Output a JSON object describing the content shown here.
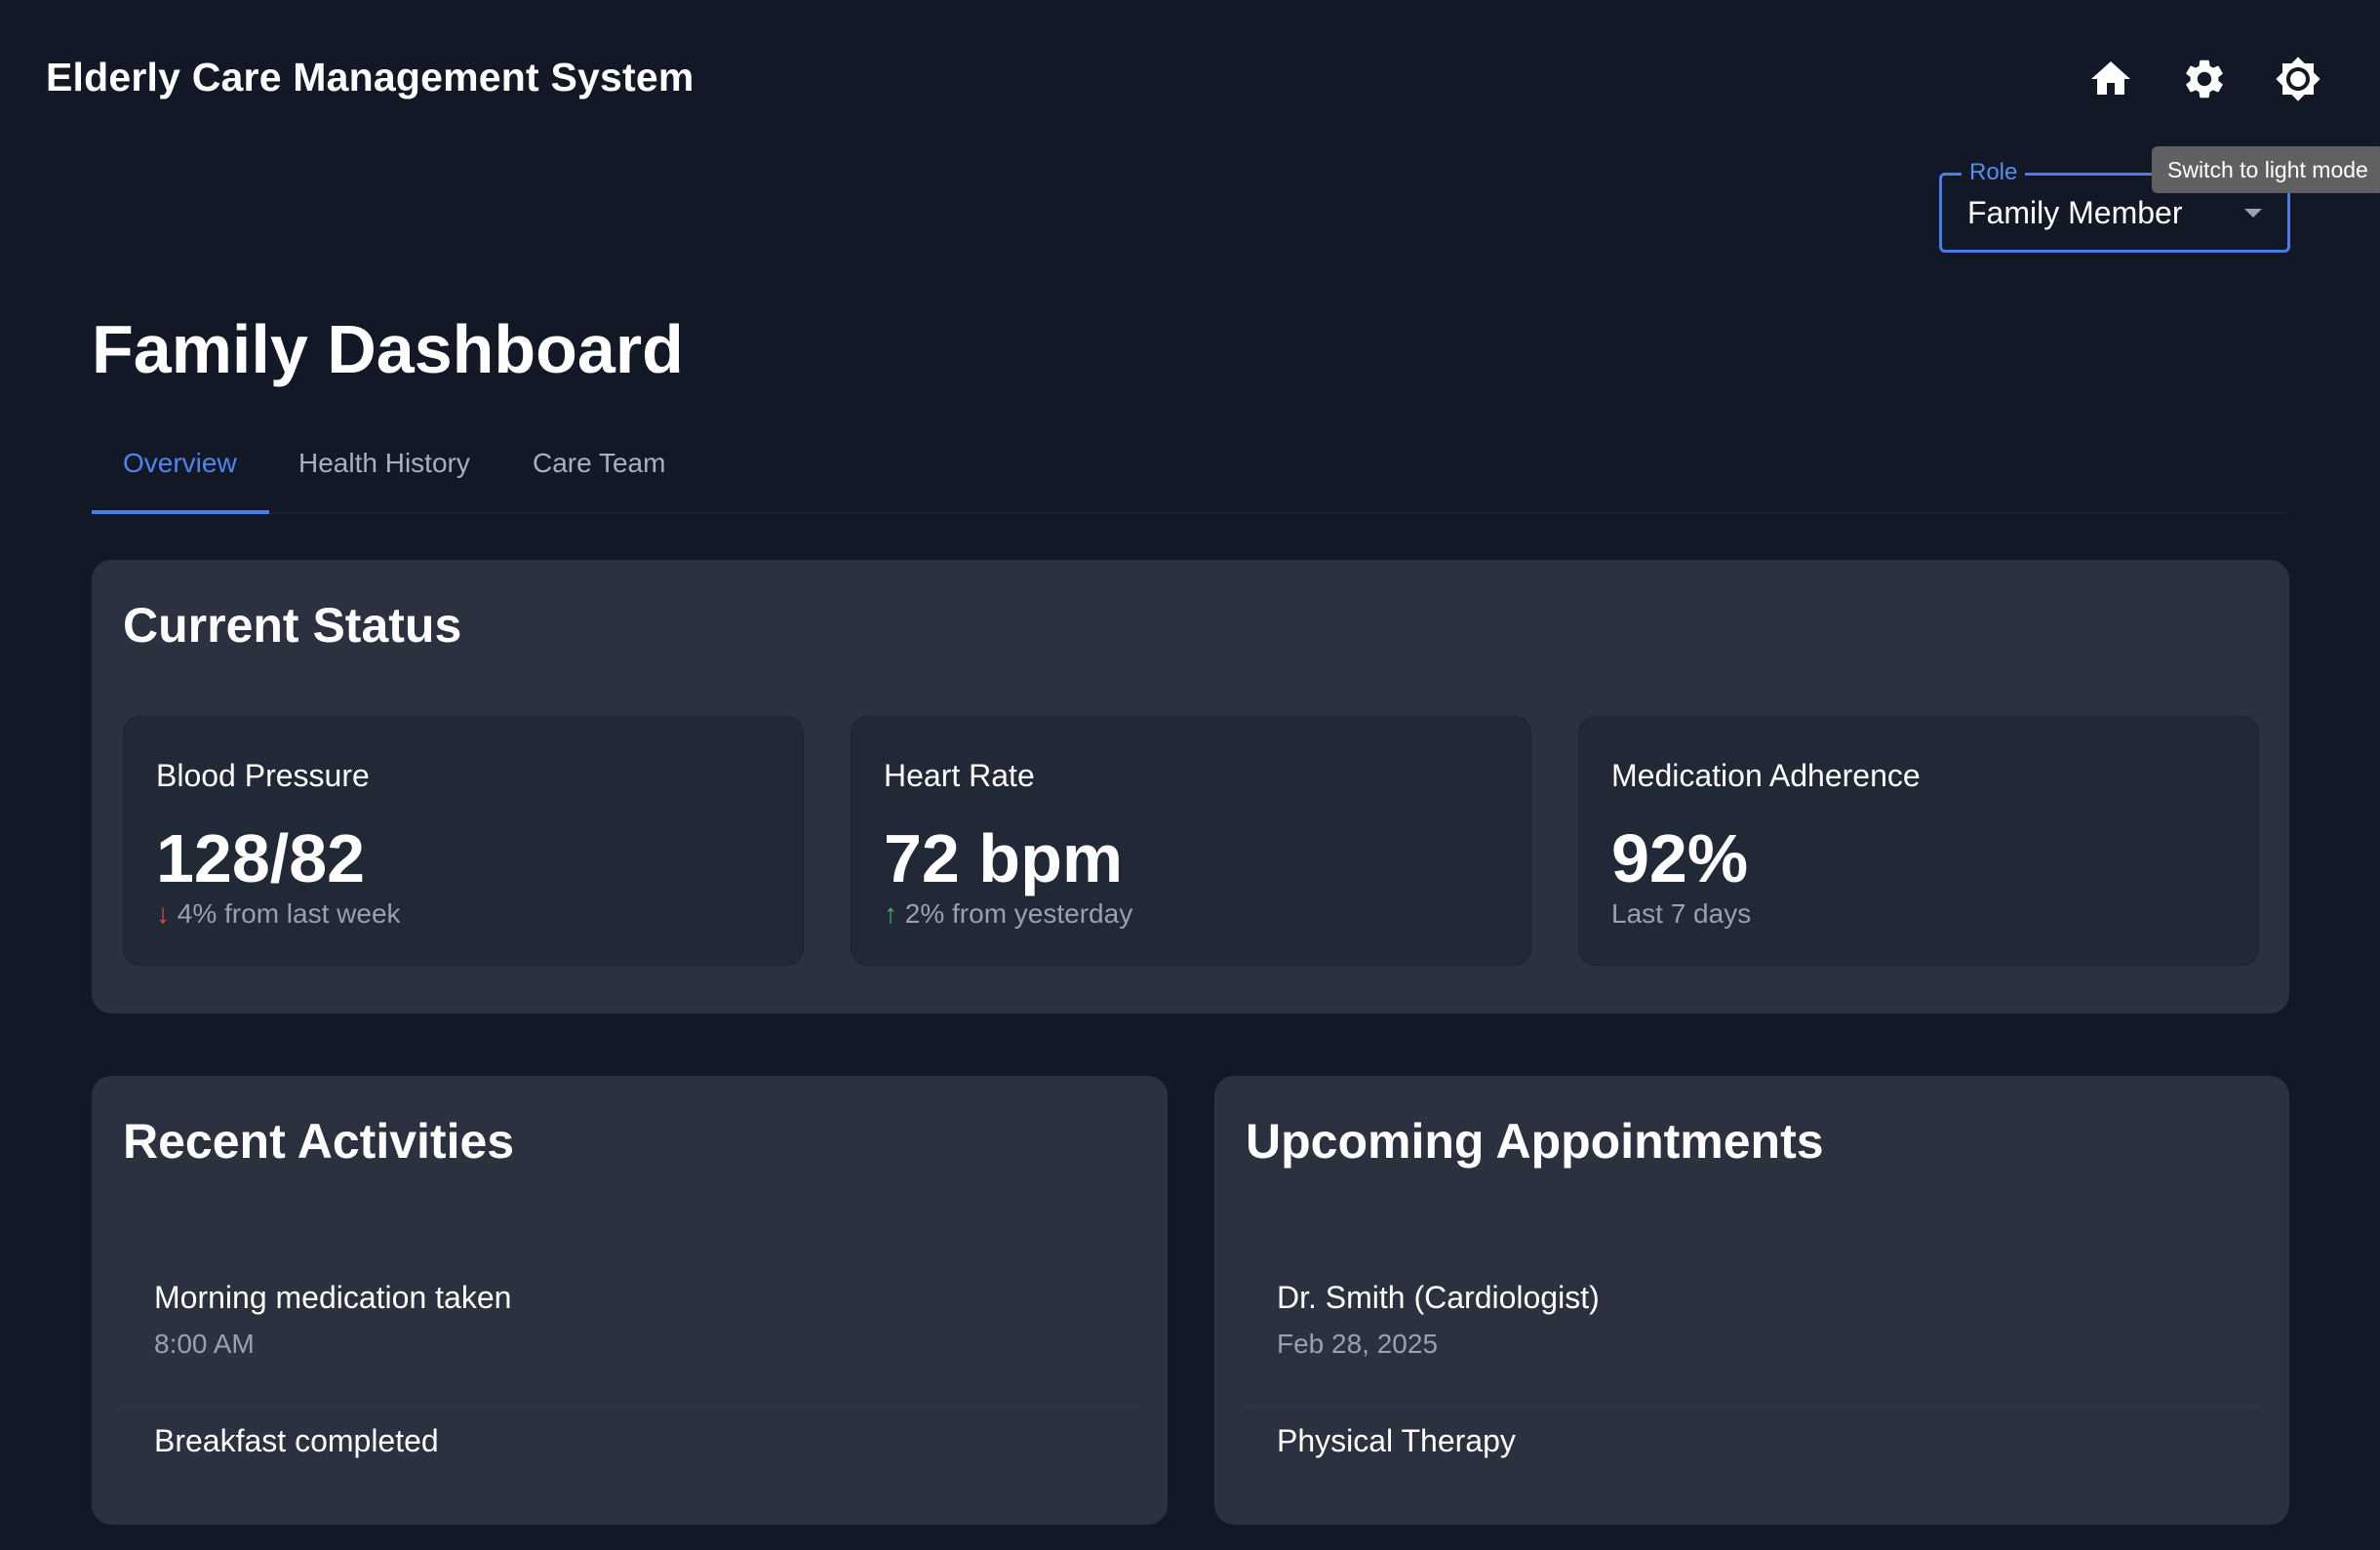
{
  "app": {
    "title": "Elderly Care Management System",
    "tooltip": "Switch to light mode"
  },
  "role": {
    "label": "Role",
    "value": "Family Member"
  },
  "page": {
    "title": "Family Dashboard"
  },
  "tabs": [
    {
      "label": "Overview",
      "active": true
    },
    {
      "label": "Health History",
      "active": false
    },
    {
      "label": "Care Team",
      "active": false
    }
  ],
  "current_status": {
    "title": "Current Status",
    "cards": [
      {
        "label": "Blood Pressure",
        "value": "128/82",
        "arrow": "↓",
        "trend": "4% from last week"
      },
      {
        "label": "Heart Rate",
        "value": "72 bpm",
        "arrow": "↑",
        "trend": "2% from yesterday"
      },
      {
        "label": "Medication Adherence",
        "value": "92%",
        "trend": "Last 7 days"
      }
    ]
  },
  "recent_activities": {
    "title": "Recent Activities",
    "items": [
      {
        "primary": "Morning medication taken",
        "secondary": "8:00 AM"
      },
      {
        "primary": "Breakfast completed",
        "secondary": ""
      }
    ]
  },
  "appointments": {
    "title": "Upcoming Appointments",
    "items": [
      {
        "primary": "Dr. Smith (Cardiologist)",
        "secondary": "Feb 28, 2025"
      },
      {
        "primary": "Physical Therapy",
        "secondary": ""
      }
    ]
  },
  "icons": {
    "home": "home-icon",
    "settings": "gear-icon",
    "theme": "brightness-icon"
  },
  "colors": {
    "background": "#121826",
    "panel": "#2b313e",
    "card": "#212836",
    "accent": "#4a7de8",
    "down": "#e5484d",
    "up": "#3fb47a"
  }
}
